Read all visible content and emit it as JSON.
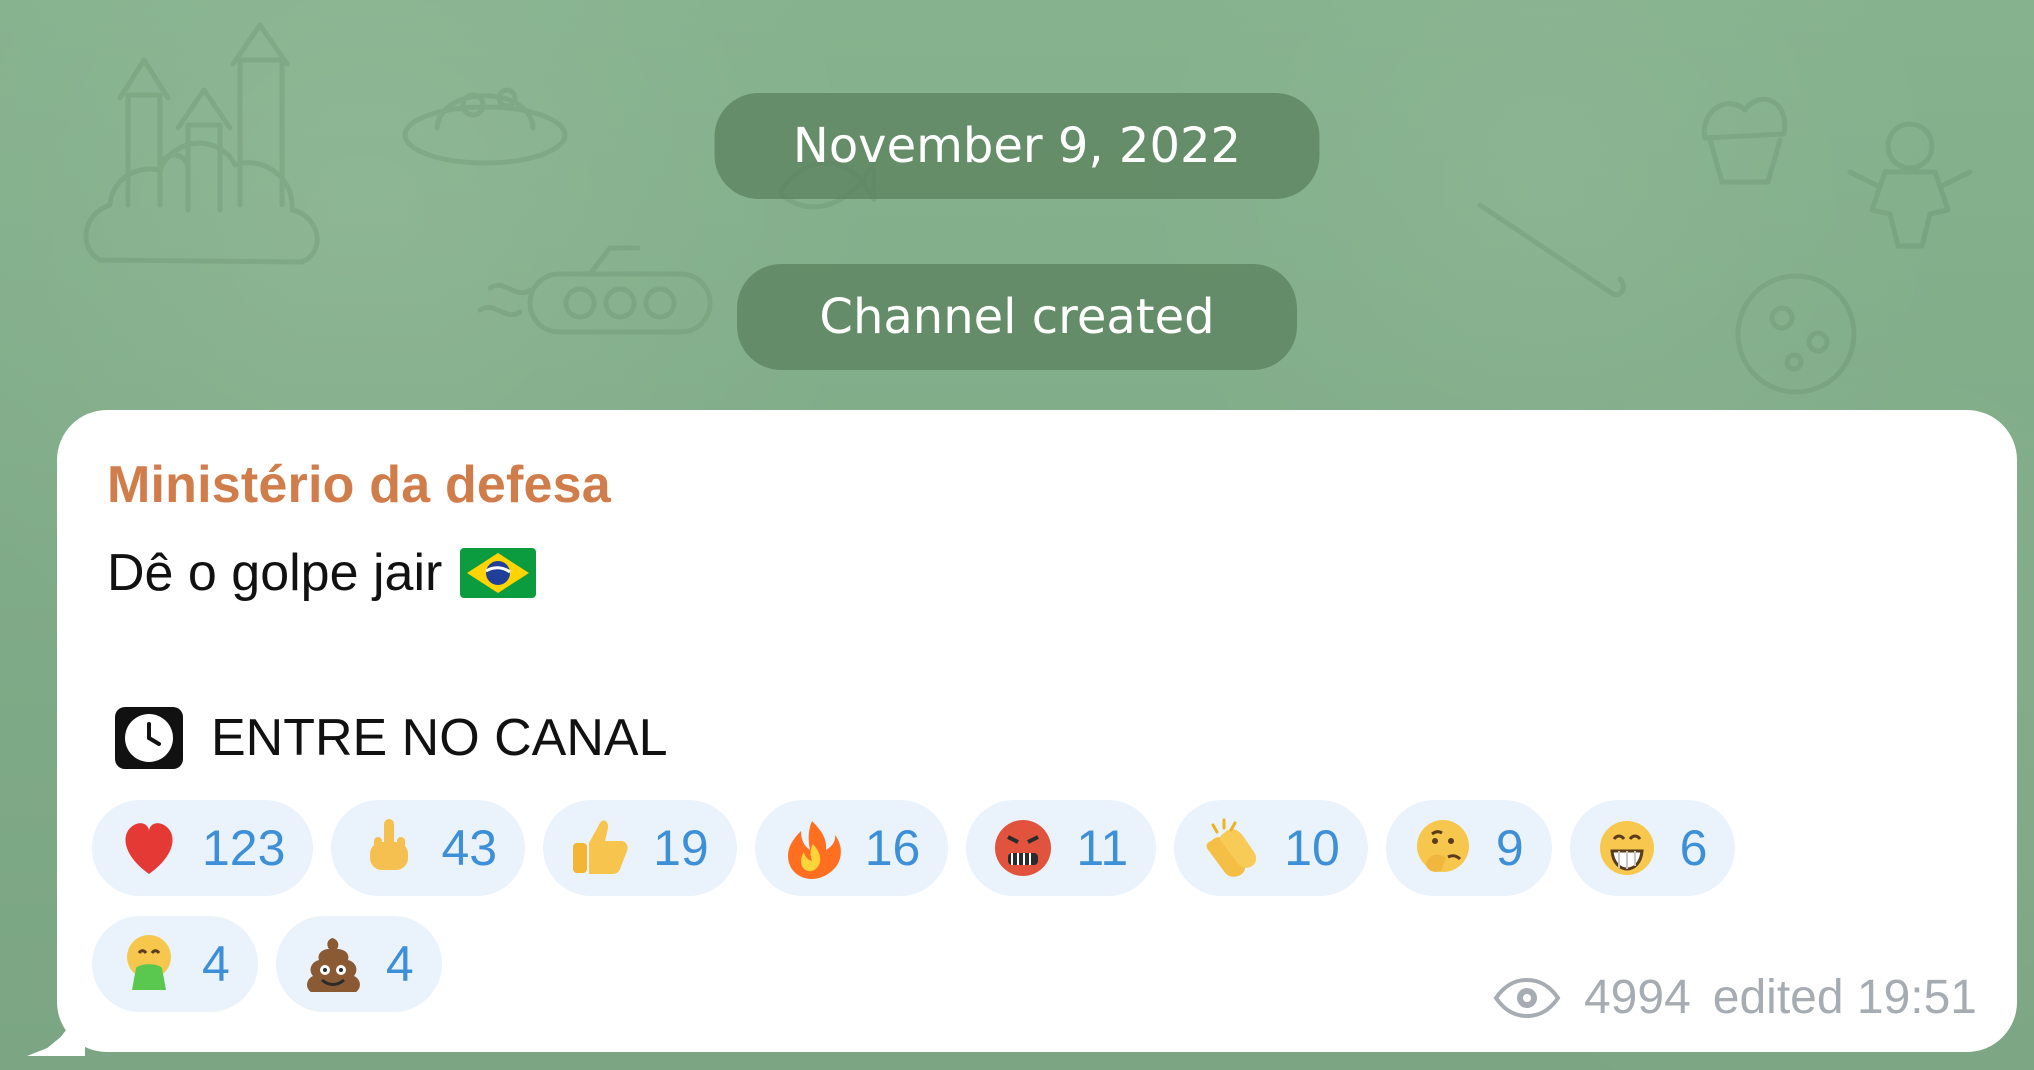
{
  "chat": {
    "date_label": "November 9, 2022",
    "service_label": "Channel created",
    "sender_name": "Ministério da defesa",
    "message_line_1": "Dê o golpe jair",
    "message_line_2": "ENTRE NO CANAL",
    "views": "4994",
    "edited_time": "edited 19:51"
  },
  "reactions": {
    "row_1": [
      {
        "emoji": "heart",
        "count": "123"
      },
      {
        "emoji": "middle-finger",
        "count": "43"
      },
      {
        "emoji": "thumbs-up",
        "count": "19"
      },
      {
        "emoji": "fire",
        "count": "16"
      },
      {
        "emoji": "angry-face",
        "count": "11"
      },
      {
        "emoji": "clapping-hands",
        "count": "10"
      },
      {
        "emoji": "thinking-face",
        "count": "9"
      },
      {
        "emoji": "grinning-face",
        "count": "6"
      }
    ],
    "row_2": [
      {
        "emoji": "vomiting-face",
        "count": "4"
      },
      {
        "emoji": "poop",
        "count": "4"
      }
    ]
  },
  "colors": {
    "wallpaper": "#7fab86",
    "service_pill": "#5c835f",
    "bubble": "#ffffff",
    "sender": "#d17d4b",
    "reaction_bg": "#eaf3fb",
    "reaction_text": "#3d90d7",
    "meta_text": "#a6acb2"
  }
}
